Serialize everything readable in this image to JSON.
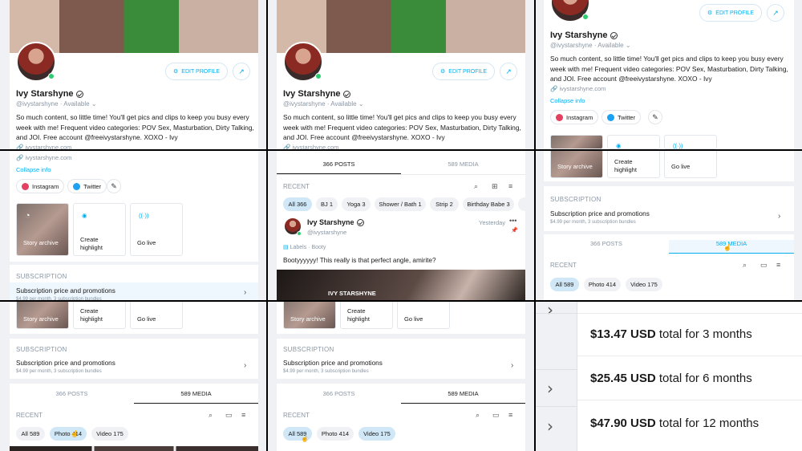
{
  "profile": {
    "name": "Ivy Starshyne",
    "handle": "@ivystarshyne",
    "status": "Available",
    "bio": "So much content, so little time! You'll get pics and clips to keep you busy every week with me! Frequent video categories: POV Sex, Masturbation, Dirty Talking, and JOI. Free account @freeivystarshyne. XOXO - Ivy",
    "website": "ivystarshyne.com",
    "collapse": "Collapse info",
    "edit_profile": "EDIT PROFILE",
    "socials": [
      "Instagram",
      "Twitter"
    ]
  },
  "highlights": {
    "story_archive": "Story archive",
    "create_highlight": "Create highlight",
    "go_live": "Go live"
  },
  "subscription": {
    "header": "SUBSCRIPTION",
    "title": "Subscription price and promotions",
    "detail": "$4.99 per month, 3 subscription bundles"
  },
  "tabs": {
    "posts": "366 POSTS",
    "media": "589 MEDIA"
  },
  "recent": "RECENT",
  "post_filters": [
    "All 366",
    "BJ 1",
    "Yoga 3",
    "Shower / Bath 1",
    "Strip 2",
    "Birthday Babe 3"
  ],
  "media_filters": [
    "All 589",
    "Photo 414",
    "Video 175"
  ],
  "post": {
    "name": "Ivy Starshyne",
    "handle": "@ivystarshyne",
    "time": "Yesterday",
    "labels": "Labels",
    "label_value": "Booty",
    "text": "Bootyyyyyy! This really is that perfect angle, amirite?",
    "watermark": "IVY STARSHYNE"
  },
  "bundles": [
    {
      "price": "$13.47 USD",
      "desc": " total for 3 months"
    },
    {
      "price": "$25.45 USD",
      "desc": " total for 6 months"
    },
    {
      "price": "$47.90 USD",
      "desc": " total for 12 months"
    }
  ],
  "colors": {
    "accent": "#00aff0",
    "online": "#2ecc71",
    "panel_bg": "#f0f1f4"
  }
}
